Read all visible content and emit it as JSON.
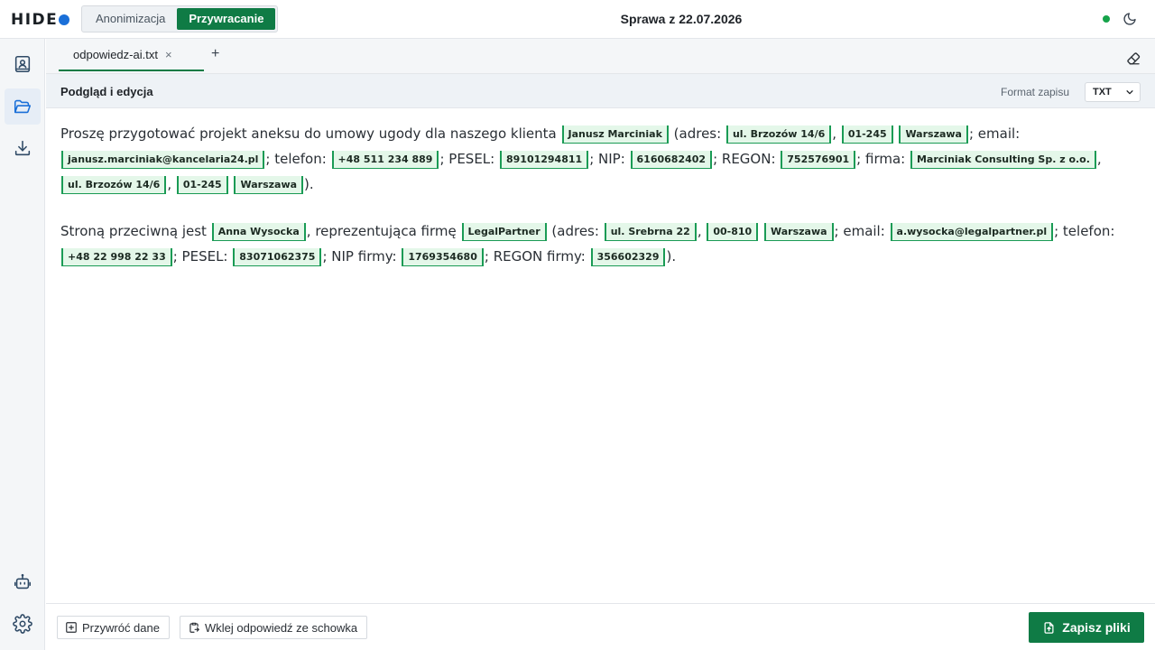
{
  "header": {
    "logo_text": "HIDE",
    "modes": [
      "Anonimizacja",
      "Przywracanie"
    ],
    "active_mode": "Przywracanie",
    "case_title": "Sprawa z 22.07.2026",
    "status_color": "#16a34a"
  },
  "sidebar": {
    "items": [
      {
        "icon": "contact-book-icon"
      },
      {
        "icon": "folder-open-icon",
        "active": true
      },
      {
        "icon": "download-icon"
      },
      {
        "icon": "robot-icon"
      },
      {
        "icon": "gear-icon"
      }
    ]
  },
  "tabs": {
    "items": [
      {
        "label": "odpowiedz-ai.txt",
        "close": "×"
      }
    ],
    "add": "+"
  },
  "section": {
    "title": "Podgląd i edycja",
    "format_label": "Format zapisu",
    "format_value": "TXT"
  },
  "content": {
    "p1": {
      "t1": "Proszę przygotować projekt aneksu do umowy ugody dla naszego klienta ",
      "e1": "Janusz Marciniak",
      "t2": " (adres: ",
      "e2": "ul. Brzozów 14/6",
      "t3": ", ",
      "e3": "01-245",
      "t4": " ",
      "e4": "Warszawa",
      "t5": "; email: ",
      "e5": "janusz.marciniak@kancelaria24.pl",
      "t6": "; telefon: ",
      "e6": "+48 511 234 889",
      "t7": "; PESEL: ",
      "e7": "89101294811",
      "t8": "; NIP: ",
      "e8": "6160682402",
      "t9": "; REGON: ",
      "e9": "752576901",
      "t10": "; firma: ",
      "e10": "Marciniak Consulting Sp. z o.o.",
      "t11": ", ",
      "e11": "ul. Brzozów 14/6",
      "t12": ", ",
      "e12": "01-245",
      "t13": " ",
      "e13": "Warszawa",
      "t14": ")."
    },
    "p2": {
      "t1": "Stroną przeciwną jest ",
      "e1": "Anna Wysocka",
      "t2": ", reprezentująca firmę ",
      "e2": "LegalPartner",
      "t3": " (adres: ",
      "e3": "ul. Srebrna 22",
      "t4": ", ",
      "e4": "00-810",
      "t5": " ",
      "e5": "Warszawa",
      "t6": "; email: ",
      "e6": "a.wysocka@legalpartner.pl",
      "t7": "; telefon: ",
      "e7": "+48 22 998 22 33",
      "t8": "; PESEL: ",
      "e8": "83071062375",
      "t9": "; NIP firmy: ",
      "e9": "1769354680",
      "t10": "; REGON firmy: ",
      "e10": "356602329",
      "t11": ")."
    }
  },
  "footer": {
    "restore_label": "Przywróć dane",
    "paste_label": "Wklej odpowiedź ze schowka",
    "save_label": "Zapisz pliki"
  },
  "colors": {
    "accent": "#0f7b45",
    "entity_bg": "#e4f7e9",
    "entity_border": "#1a9b55",
    "logo_dot": "#1a6fd8"
  }
}
